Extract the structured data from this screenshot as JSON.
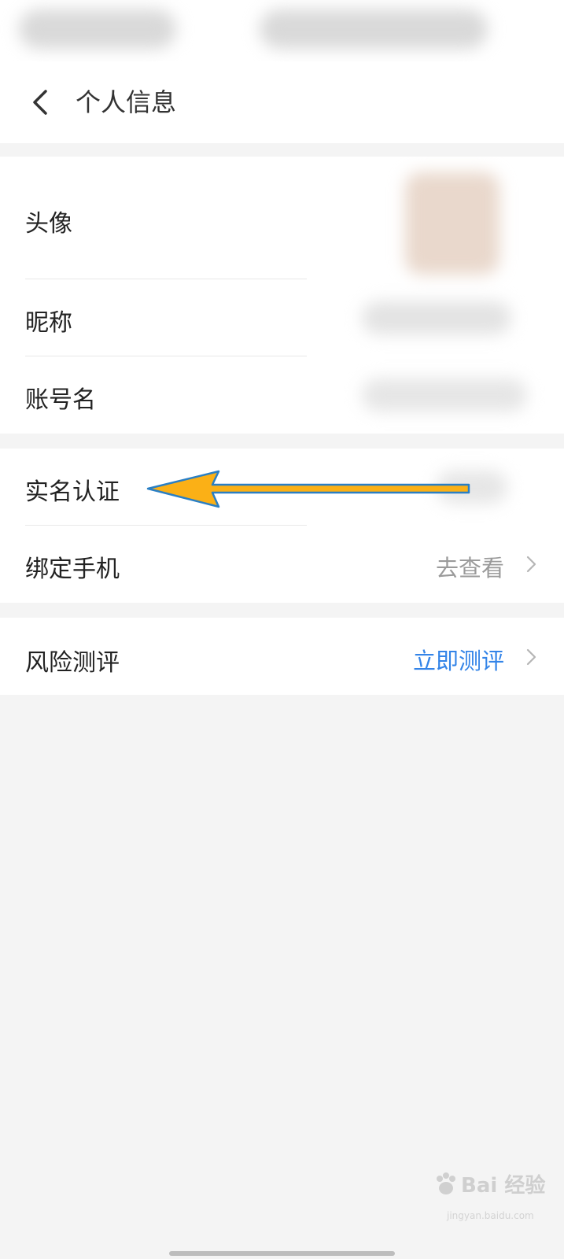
{
  "header": {
    "title": "个人信息",
    "back_icon": "chevron-left-icon"
  },
  "profile_section": {
    "avatar_label": "头像",
    "nickname_label": "昵称",
    "account_label": "账号名"
  },
  "verify_section": {
    "realname_label": "实名认证",
    "bind_phone_label": "绑定手机",
    "bind_phone_value": "去查看"
  },
  "risk_section": {
    "label": "风险测评",
    "value": "立即测评"
  },
  "colors": {
    "link_blue": "#3384e8",
    "muted_gray": "#9a9a9a",
    "arrow_fill": "#fbb016",
    "arrow_stroke": "#2a7fc4"
  },
  "watermark": {
    "text": "Bai 经验",
    "url": "jingyan.baidu.com"
  }
}
